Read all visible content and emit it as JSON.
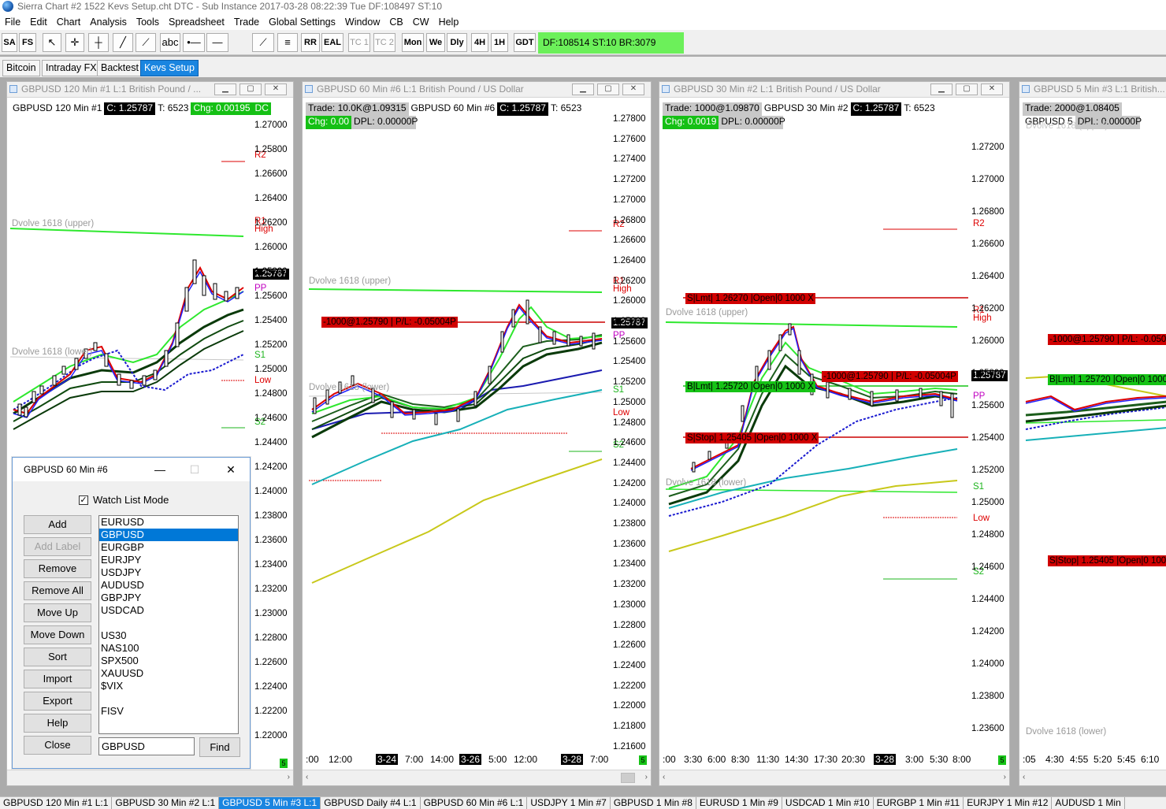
{
  "app": {
    "title": "Sierra Chart #2 1522 Kevs Setup.cht  DTC - Sub Instance 2017-03-28  08:22:39 Tue  DF:108497  ST:10"
  },
  "menu": [
    "File",
    "Edit",
    "Chart",
    "Analysis",
    "Tools",
    "Spreadsheet",
    "Trade",
    "Global Settings",
    "Window",
    "CB",
    "CW",
    "Help"
  ],
  "toolbar": {
    "sa": "SA",
    "fs": "FS",
    "rr": "RR",
    "eal": "EAL",
    "tc1": "TC 1",
    "tc2": "TC 2",
    "mon": "Mon",
    "we": "We",
    "dly": "Dly",
    "h4": "4H",
    "h1": "1H",
    "gdt": "GDT",
    "status": "DF:108514  ST:10  BR:3079",
    "abc": "abc",
    "status_color": "#6cf05a"
  },
  "tabs": [
    {
      "label": "Bitcoin"
    },
    {
      "label": "Intraday FX"
    },
    {
      "label": "Backtest"
    },
    {
      "label": "Kevs Setup",
      "active": true
    }
  ],
  "charts": {
    "c1": {
      "title": "GBPUSD  120 Min  #1  L:1  British Pound / ...",
      "info": {
        "sym": "GBPUSD  120 Min  #1",
        "c": "C: 1.25787",
        "t": "T: 6523",
        "chg": "Chg: 0.00195",
        "dc": "DC"
      },
      "y": [
        "1.27000",
        "1.25800",
        "1.26600",
        "1.26400",
        "1.26200",
        "1.26000",
        "1.25800",
        "1.25600",
        "1.25400",
        "1.25200",
        "1.25000",
        "1.24800",
        "1.24600",
        "1.24400",
        "1.24200",
        "1.24000",
        "1.23800",
        "1.23600",
        "1.23400",
        "1.23200",
        "1.23000",
        "1.22800",
        "1.22600",
        "1.22400",
        "1.22200",
        "1.22000"
      ],
      "price": "1.25787",
      "r2": "R2",
      "r1": "R1",
      "high": "High",
      "pp": "PP",
      "s1": "S1",
      "low": "Low",
      "s2": "S2",
      "upper": "Dvolve 1618 (upper)",
      "lower": "Dvolve 1618 (lower)",
      "r1v": "1.2600",
      "s2v": "4600"
    },
    "c2": {
      "title": "GBPUSD  60 Min  #6  L:1  British Pound / US Dollar",
      "trade": "Trade: 10.0K@1.09315",
      "sym": "GBPUSD  60 Min  #6",
      "c": "C: 1.25787",
      "t": "T: 6523",
      "chg": "Chg: 0.00",
      "dpl": "DPL: 0.00000P",
      "y": [
        "1.27800",
        "1.27600",
        "1.27400",
        "1.27200",
        "1.27000",
        "1.26800",
        "1.26600",
        "1.26400",
        "1.26200",
        "1.26000",
        "1.25800",
        "1.25600",
        "1.25400",
        "1.25200",
        "1.25000",
        "1.24800",
        "1.24600",
        "1.24400",
        "1.24200",
        "1.24000",
        "1.23800",
        "1.23600",
        "1.23400",
        "1.23200",
        "1.23000",
        "1.22800",
        "1.22600",
        "1.22400",
        "1.22200",
        "1.22000",
        "1.21800",
        "1.21600"
      ],
      "price": "1.25787",
      "pos": "-1000@1.25790 | P/L: -0.05004P",
      "upper": "Dvolve 1618 (upper)",
      "lower": "Dvolve 1618 (lower)",
      "r2": "R2",
      "r1": "R1",
      "high": "High",
      "pp": "PP",
      "s1": "S1",
      "low": "Low",
      "s2": "S2",
      "r1v": "1.2600",
      "s2v": "4600",
      "x": [
        ":00",
        "12:00",
        "3-24",
        "7:00",
        "14:00",
        "3-26",
        "5:00",
        "12:00",
        "3-28",
        "7:00"
      ]
    },
    "c3": {
      "title": "GBPUSD  30 Min  #2  L:1  British Pound / US Dollar",
      "trade": "Trade: 1000@1.09870",
      "sym": "GBPUSD  30 Min  #2",
      "c": "C: 1.25787",
      "t": "T: 6523",
      "chg": "Chg: 0.0019",
      "dpl": "DPL: 0.00000P",
      "y": [
        "1.27200",
        "1.27000",
        "1.26800",
        "1.26600",
        "1.26400",
        "1.26200",
        "1.26000",
        "1.25800",
        "1.25600",
        "1.25400",
        "1.25200",
        "1.25000",
        "1.24800",
        "1.24600",
        "1.24400",
        "1.24200",
        "1.24000",
        "1.23800",
        "1.23600"
      ],
      "price": "1.25787",
      "slmt": "S|Lmt| 1.26270 |Open|0  1000 X",
      "blmt": "B|Lmt| 1.25720 |Open|0  1000 X",
      "sstop": "S|Stop| 1.25405 |Open|0  1000 X",
      "pos": "-1000@1.25790 | P/L: -0.05004P",
      "upper": "Dvolve 1618 (upper)",
      "lower": "Dvolve 1618 (lower)",
      "r2": "R2",
      "r1": "R1",
      "high": "High",
      "pp": "PP",
      "s1": "S1",
      "low": "Low",
      "s2": "S2",
      "r1v": "1.2600",
      "s2v": "4600",
      "x": [
        ":00",
        "3:30",
        "6:00",
        "8:30",
        "11:30",
        "14:30",
        "17:30",
        "20:30",
        "3-28",
        "3:00",
        "5:30",
        "8:00"
      ]
    },
    "c4": {
      "title": "GBPUSD  5 Min  #3  L:1  British...",
      "trade": "Trade: 2000@1.08405",
      "sym": "GBPUSD  5",
      "dpl": "DPL: 0.00000P",
      "pos": "-1000@1.25790 | P/L: -0.0500",
      "blmt": "B|Lmt| 1.25720 |Open|0  1000",
      "sstop": "S|Stop| 1.25405 |Open|0  100",
      "upper": "Dvolve 1618 (upper)",
      "lower": "Dvolve 1618 (lower)",
      "x": [
        ":05",
        "4:30",
        "4:55",
        "5:20",
        "5:45",
        "6:10"
      ]
    }
  },
  "dialog": {
    "title": "GBPUSD  60 Min  #6",
    "watch_label": "Watch List Mode",
    "watch_checked": true,
    "buttons": [
      "Add",
      "Add Label",
      "Remove",
      "Remove All",
      "Move Up",
      "Move Down",
      "Sort",
      "Import",
      "Export",
      "Help",
      "Close"
    ],
    "list": [
      "EURUSD",
      "GBPUSD",
      "EURGBP",
      "EURJPY",
      "USDJPY",
      "AUDUSD",
      "GBPJPY",
      "USDCAD",
      "",
      "US30",
      "NAS100",
      "SPX500",
      "XAUUSD",
      "$VIX",
      "",
      "FISV"
    ],
    "selected": "GBPUSD",
    "input": "GBPUSD",
    "find": "Find"
  },
  "bottom_tabs": [
    "GBPUSD  120 Min  #1  L:1",
    "GBPUSD  30 Min  #2  L:1",
    "GBPUSD  5 Min  #3  L:1",
    "GBPUSD  Daily  #4  L:1",
    "GBPUSD  60 Min  #6  L:1",
    "USDJPY  1 Min  #7",
    "GBPUSD  1 Min  #8",
    "EURUSD  1 Min  #9",
    "USDCAD  1 Min  #10",
    "EURGBP  1 Min  #11",
    "EURJPY  1 Min  #12",
    "AUDUSD  1 Min"
  ],
  "bottom_active": 2,
  "gbox": "5"
}
